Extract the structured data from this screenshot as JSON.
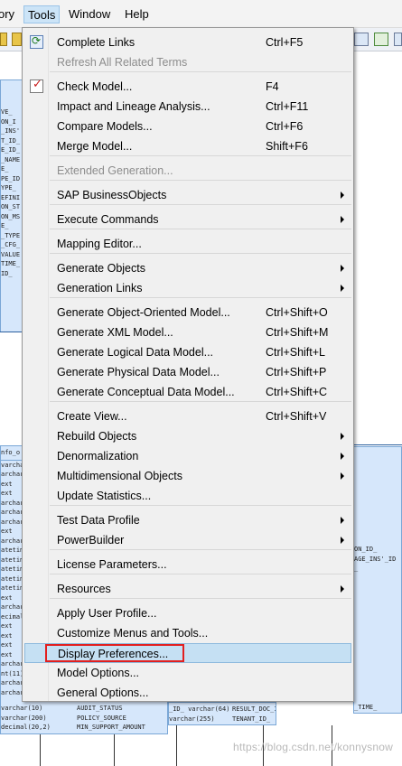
{
  "menubar": {
    "items": [
      {
        "label": "ory"
      },
      {
        "label": "Tools"
      },
      {
        "label": "Window"
      },
      {
        "label": "Help"
      }
    ]
  },
  "diagram": {
    "left_entity_lines": [
      "VE_",
      "ON_I",
      "_INS'",
      "T_ID_",
      "E_ID_",
      "_NAME",
      "E_",
      "PE_ID",
      "YPE_",
      "EFINI",
      "",
      "ON_ST",
      "ON_MS",
      "E_",
      "",
      "_TYPE",
      "_CFG_",
      "VALUE",
      "TIME_",
      "ID_"
    ],
    "lower_entity_header": "nfo_o",
    "lower_entity_lines": [
      "varchar",
      "archar",
      "ext",
      "ext",
      "archar",
      "archar",
      "archar",
      "ext",
      "archar",
      "atetim",
      "atetim",
      "atetim",
      "atetim",
      "atetim",
      "ext",
      "archar",
      "ecimal",
      "ext",
      "ext",
      "ext",
      "ext",
      "archar",
      "nt(11)",
      "archar",
      "archar"
    ],
    "bottom_rows": [
      {
        "type": "varchar(10)",
        "name": "AUDIT_STATUS"
      },
      {
        "type": "varchar(200)",
        "name": "POLICY_SOURCE"
      },
      {
        "type": "decimal(20,2)",
        "name": "MIN_SUPPORT_AMOUNT"
      }
    ],
    "mid_bottom_rows": [
      {
        "type": "_ID_ varchar(64)",
        "name": "RESULT_DOC_ID_"
      },
      {
        "type": "varchar(255)",
        "name": "TENANT_ID_"
      }
    ],
    "right_entity_lines": [
      "ON_ID_",
      "AGE_INS'_ID",
      "_"
    ],
    "right_bottom_text": "_TIME_",
    "watermark": "https://blog.csdn.net/konnysnow"
  },
  "menu": {
    "items": [
      {
        "id": "complete-links",
        "label": "Complete Links",
        "shortcut": "Ctrl+F5",
        "icon": "refresh-icon"
      },
      {
        "id": "refresh-related-terms",
        "label": "Refresh All Related Terms",
        "disabled": true
      },
      {
        "id": "check-model",
        "label": "Check Model...",
        "shortcut": "F4",
        "icon": "check-model-icon"
      },
      {
        "id": "impact-lineage",
        "label": "Impact and Lineage Analysis...",
        "shortcut": "Ctrl+F11"
      },
      {
        "id": "compare-models",
        "label": "Compare Models...",
        "shortcut": "Ctrl+F6"
      },
      {
        "id": "merge-model",
        "label": "Merge Model...",
        "shortcut": "Shift+F6"
      },
      {
        "id": "extended-generation",
        "label": "Extended Generation...",
        "disabled": true
      },
      {
        "id": "sap-businessobjects",
        "label": "SAP BusinessObjects",
        "submenu": true
      },
      {
        "id": "execute-commands",
        "label": "Execute Commands",
        "submenu": true
      },
      {
        "id": "mapping-editor",
        "label": "Mapping Editor..."
      },
      {
        "id": "generate-objects",
        "label": "Generate Objects",
        "submenu": true
      },
      {
        "id": "generation-links",
        "label": "Generation Links",
        "submenu": true
      },
      {
        "id": "generate-oom",
        "label": "Generate Object-Oriented Model...",
        "shortcut": "Ctrl+Shift+O"
      },
      {
        "id": "generate-xml",
        "label": "Generate XML Model...",
        "shortcut": "Ctrl+Shift+M"
      },
      {
        "id": "generate-ldm",
        "label": "Generate Logical Data Model...",
        "shortcut": "Ctrl+Shift+L"
      },
      {
        "id": "generate-pdm",
        "label": "Generate Physical Data Model...",
        "shortcut": "Ctrl+Shift+P"
      },
      {
        "id": "generate-cdm",
        "label": "Generate Conceptual Data Model...",
        "shortcut": "Ctrl+Shift+C"
      },
      {
        "id": "create-view",
        "label": "Create View...",
        "shortcut": "Ctrl+Shift+V"
      },
      {
        "id": "rebuild-objects",
        "label": "Rebuild Objects",
        "submenu": true
      },
      {
        "id": "denormalization",
        "label": "Denormalization",
        "submenu": true
      },
      {
        "id": "multidimensional-objects",
        "label": "Multidimensional Objects",
        "submenu": true
      },
      {
        "id": "update-statistics",
        "label": "Update Statistics..."
      },
      {
        "id": "test-data-profile",
        "label": "Test Data Profile",
        "submenu": true
      },
      {
        "id": "powerbuilder",
        "label": "PowerBuilder",
        "submenu": true
      },
      {
        "id": "license-parameters",
        "label": "License Parameters..."
      },
      {
        "id": "resources",
        "label": "Resources",
        "submenu": true
      },
      {
        "id": "apply-user-profile",
        "label": "Apply User Profile..."
      },
      {
        "id": "customize-menus",
        "label": "Customize Menus and Tools..."
      },
      {
        "id": "display-preferences",
        "label": "Display Preferences...",
        "highlighted": true
      },
      {
        "id": "model-options",
        "label": "Model Options..."
      },
      {
        "id": "general-options",
        "label": "General Options..."
      }
    ]
  },
  "colors": {
    "highlight_fill": "#c5e0f3",
    "annotation_box": "#e21f1f",
    "entity_fill": "#d6e7fb"
  }
}
